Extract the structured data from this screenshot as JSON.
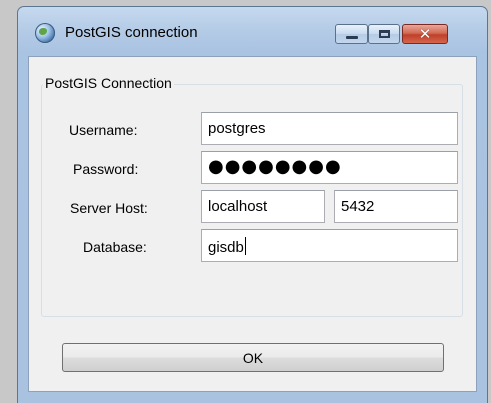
{
  "window": {
    "title": "PostGIS connection",
    "icon": "globe-icon"
  },
  "form": {
    "group_label": "PostGIS Connection",
    "username_label": "Username:",
    "username_value": "postgres",
    "password_label": "Password:",
    "password_value": "●●●●●●●●",
    "server_host_label": "Server Host:",
    "server_host_value": "localhost",
    "port_value": "5432",
    "database_label": "Database:",
    "database_value": "gisdb"
  },
  "buttons": {
    "ok_label": "OK",
    "close_glyph": "✕"
  }
}
